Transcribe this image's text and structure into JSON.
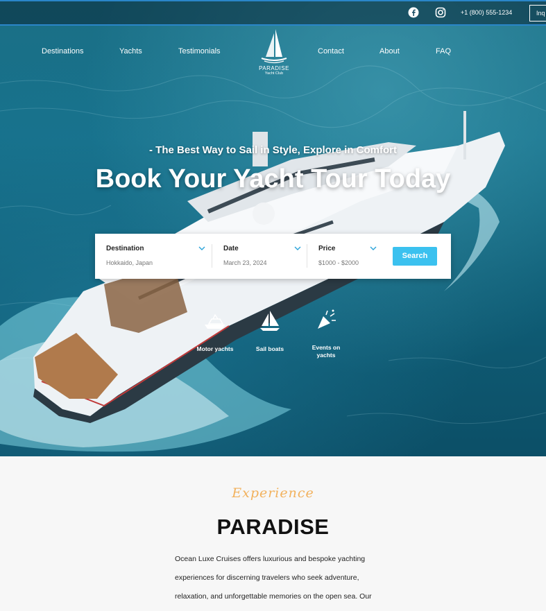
{
  "topbar": {
    "phone": "+1 (800) 555-1234",
    "inquire_label": "Inq",
    "icons": [
      "facebook-icon",
      "instagram-icon"
    ]
  },
  "nav": {
    "left": [
      "Destinations",
      "Yachts",
      "Testimonials"
    ],
    "right": [
      "Contact",
      "About",
      "FAQ"
    ]
  },
  "logo": {
    "name": "PARADISE",
    "sub": "Yacht Club"
  },
  "hero": {
    "tagline": "- The Best Way to Sail in Style, Explore in Comfort",
    "headline": "Book Your Yacht Tour Today"
  },
  "search": {
    "destination": {
      "label": "Destination",
      "value": "Hokkaido, Japan"
    },
    "date": {
      "label": "Date",
      "value": "March 23, 2024"
    },
    "price": {
      "label": "Price",
      "value": "$1000 - $2000"
    },
    "button": "Search"
  },
  "categories": [
    {
      "label": "Motor yachts",
      "icon": "motor-yacht-icon"
    },
    {
      "label": "Sail boats",
      "icon": "sailboat-icon"
    },
    {
      "label": "Events on yachts",
      "icon": "party-popper-icon"
    }
  ],
  "intro": {
    "script_title": "Experience",
    "title": "PARADISE",
    "lines": [
      "Ocean Luxe Cruises offers luxurious and bespoke yachting",
      "experiences for discerning travelers who seek adventure,",
      "relaxation, and unforgettable memories on the open sea. Our"
    ]
  },
  "colors": {
    "accent": "#3bc1ef",
    "script": "#f2b15c",
    "topbar_border": "#2a86c9"
  }
}
